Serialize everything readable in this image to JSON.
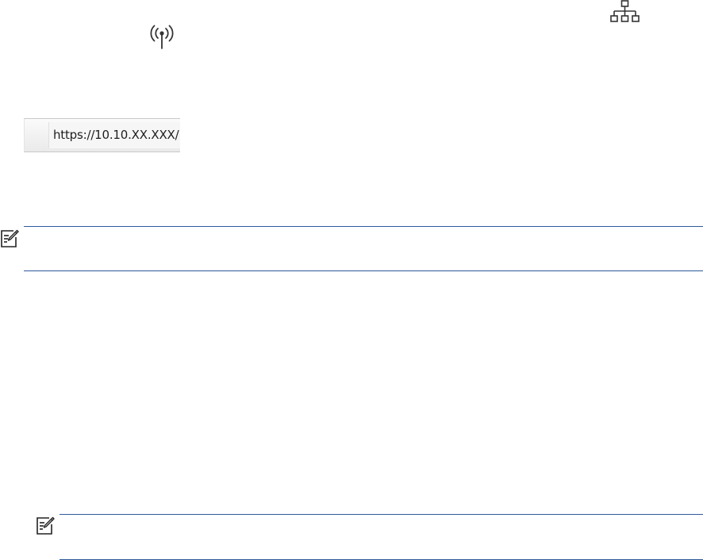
{
  "icons": {
    "network": "network-icon",
    "wireless": "wireless-icon",
    "note": "note-icon"
  },
  "address_bar": {
    "url": "https://10.10.XX.XXX/"
  },
  "colors": {
    "rule": "#2e5a9c",
    "icon": "#333333"
  }
}
